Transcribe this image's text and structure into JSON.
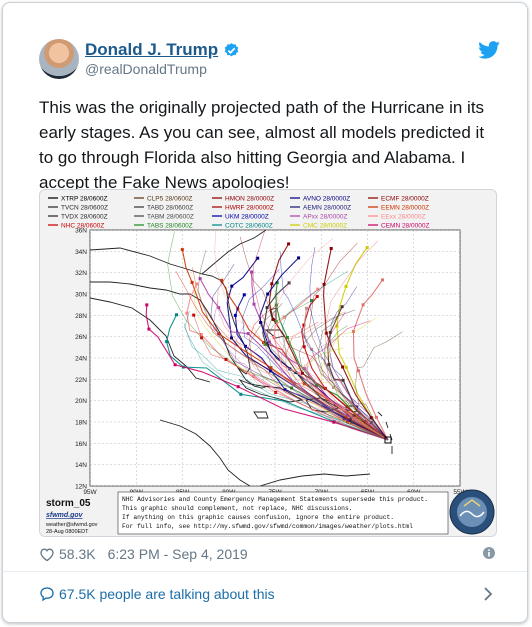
{
  "tweet": {
    "author_name": "Donald J. Trump",
    "handle": "@realDonaldTrump",
    "text": "This was the originally projected path of the Hurricane in its early stages. As you can see, almost all models predicted it to go through Florida also hitting Georgia and Alabama. I accept the Fake News apologies!",
    "likes": "58.3K",
    "timestamp": "6:23 PM - Sep 4, 2019",
    "talking_about": "67.5K people are talking about this"
  },
  "colors": {
    "link_blue": "#1b6ea8",
    "name_blue": "#1c5a8c",
    "verified_blue": "#1da1f2",
    "muted_gray": "#657786"
  },
  "icons": [
    "avatar",
    "verified-badge-icon",
    "twitter-bird-icon",
    "heart-icon",
    "info-icon",
    "comment-bubble-icon",
    "chevron-right-icon"
  ],
  "media": {
    "legend": [
      [
        "XTRP 28/0600Z",
        "CLP5 28/0600Z",
        "HMON 28/0000Z",
        "AVNO 28/0000Z",
        "ECMF 28/0000Z"
      ],
      [
        "TVCN 28/0600Z",
        "TABD 28/0600Z",
        "HWRF 28/0000Z",
        "AEMN 28/0000Z",
        "EEMN 28/0000Z"
      ],
      [
        "TVDX 28/0600Z",
        "TABM 28/0600Z",
        "UKM 28/0000Z",
        "APxx 28/0000Z",
        "EExx 28/0000Z"
      ],
      [
        "NHC 28/0600Z",
        "TABS 28/0600Z",
        "COTC 28/0600Z",
        "CMC 28/0000Z",
        "CEMN 28/0000Z"
      ]
    ],
    "legend_colors": [
      "#000000",
      "#5a3a1a",
      "#8b0000",
      "#000080",
      "#8b0000",
      "#2a2a2a",
      "#3a3a3a",
      "#aa0000",
      "#1a1a7a",
      "#cc3300",
      "#2a2a2a",
      "#4a4a4a",
      "#0000aa",
      "#aa44aa",
      "#ff8888",
      "#cc0000",
      "#228822",
      "#008888",
      "#cccc00",
      "#cc0066"
    ],
    "lat_labels": [
      "36N",
      "34N",
      "32N",
      "30N",
      "28N",
      "26N",
      "24N",
      "22N",
      "20N",
      "18N",
      "16N",
      "14N",
      "12N"
    ],
    "lon_labels": [
      "95W",
      "90W",
      "85W",
      "80W",
      "75W",
      "70W",
      "65W",
      "60W",
      "55W"
    ],
    "logo_text": "storm_05",
    "logo_site": "sfwmd.gov",
    "logo_credit": "weather@sfwmd.gov",
    "logo_date": "28-Aug 0800EDT",
    "disclaimer": [
      "NHC Advisories and County Emergency Management Statements supersede this product.",
      "This graphic should complement, not replace, NHC discussions.",
      "If anything on this graphic causes confusion, ignore the entire product.",
      "For full info, see  http://my.sfwmd.gov/sfwmd/common/images/weather/plots.html"
    ],
    "seal_text": "SOUTH FLORIDA WATER MANAGEMENT DISTRICT"
  }
}
